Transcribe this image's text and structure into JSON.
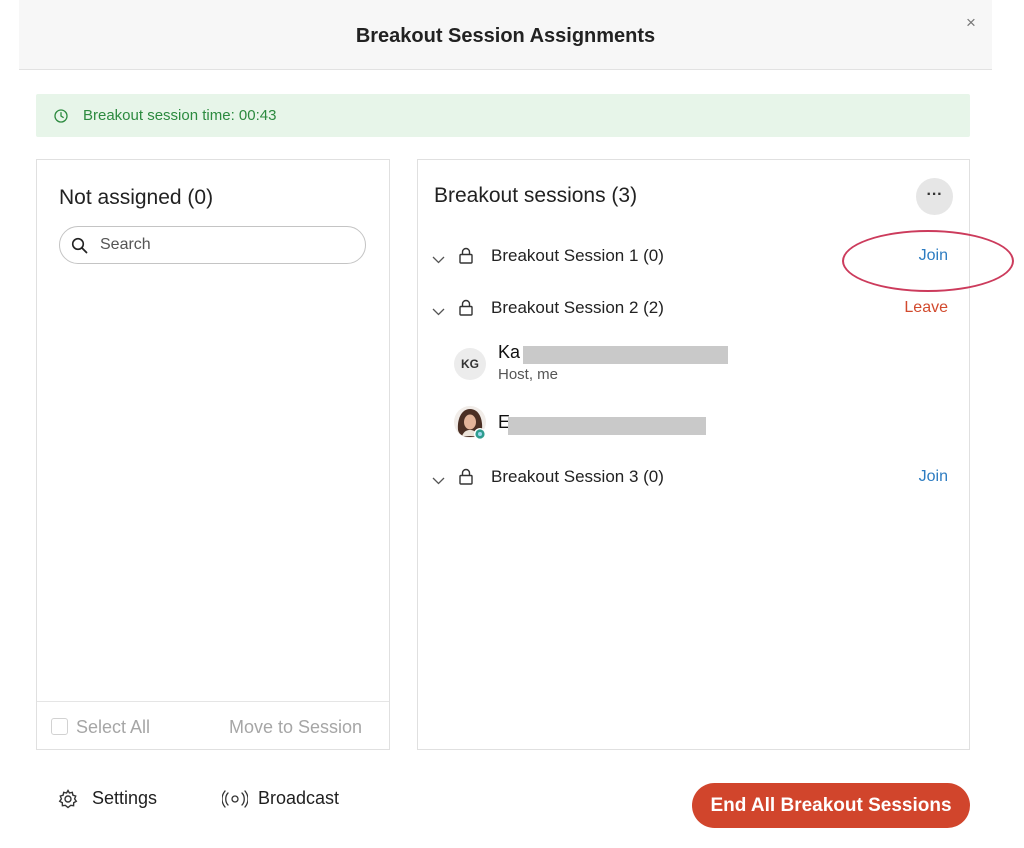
{
  "window": {
    "title": "Breakout Session Assignments",
    "close_label": "×"
  },
  "timer": {
    "label": "Breakout session time:",
    "value": "00:43",
    "icon": "clock-icon",
    "color": "#2c8a3f"
  },
  "left_panel": {
    "heading": "Not assigned (0)",
    "search": {
      "placeholder": "Search",
      "value": ""
    },
    "select_all_label": "Select All",
    "move_to_session_label": "Move to Session"
  },
  "right_panel": {
    "heading": "Breakout sessions (3)",
    "more_label": "···",
    "sessions": [
      {
        "name": "Breakout Session 1 (0)",
        "action": "Join"
      },
      {
        "name": "Breakout Session 2 (2)",
        "action": "Leave"
      },
      {
        "name": "Breakout Session 3 (0)",
        "action": "Join"
      }
    ],
    "participants": [
      {
        "initials": "KG",
        "name": "Ka",
        "role": "Host, me"
      },
      {
        "name": "E",
        "role": ""
      }
    ]
  },
  "footer": {
    "settings_label": "Settings",
    "broadcast_label": "Broadcast",
    "end_all_label": "End All Breakout Sessions"
  },
  "colors": {
    "join": "#2d7cc1",
    "leave": "#d24a2e",
    "end_button": "#d1452c",
    "highlight_circle": "#cc3b5c"
  }
}
